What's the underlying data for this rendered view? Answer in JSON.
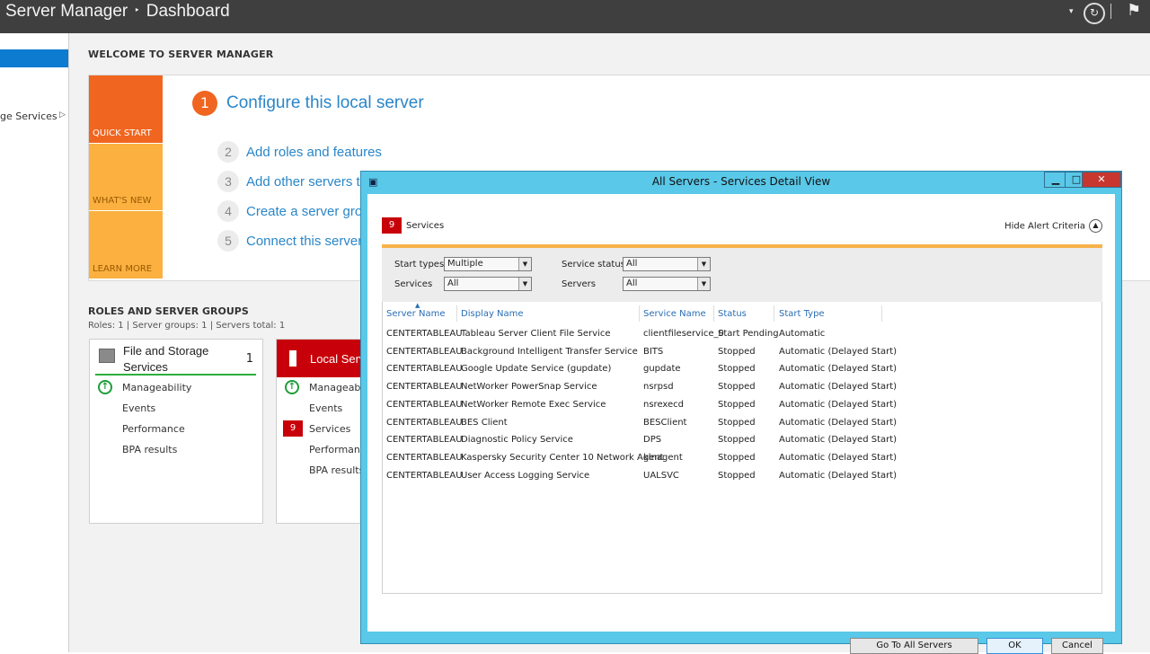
{
  "titlebar": {
    "app": "Server Manager",
    "separator": "‣",
    "page": "Dashboard"
  },
  "sidebar": {
    "selected_label": "",
    "item_label": "ge Services"
  },
  "welcome": {
    "heading": "WELCOME TO SERVER MANAGER",
    "tiles": [
      "QUICK START",
      "WHAT'S NEW",
      "LEARN MORE"
    ],
    "configure": {
      "num": "1",
      "label": "Configure this local server"
    },
    "steps": [
      {
        "num": "2",
        "label": "Add roles and features"
      },
      {
        "num": "3",
        "label": "Add other servers to manage"
      },
      {
        "num": "4",
        "label": "Create a server group"
      },
      {
        "num": "5",
        "label": "Connect this server to cloud services"
      }
    ]
  },
  "roles": {
    "heading": "ROLES AND SERVER GROUPS",
    "summary": "Roles: 1   |   Server groups: 1   |   Servers total: 1",
    "cards": [
      {
        "title_line1": "File and Storage",
        "title_line2": "Services",
        "count": "1",
        "items": [
          "Manageability",
          "Events",
          "Performance",
          "BPA results"
        ]
      },
      {
        "title": "Local Server",
        "badge": "9",
        "items": [
          "Manageability",
          "Events",
          "Services",
          "Performance",
          "BPA results"
        ]
      }
    ]
  },
  "dialog": {
    "title": "All Servers - Services Detail View",
    "services_count": "9",
    "services_label": "Services",
    "hide_alert": "Hide Alert Criteria",
    "filters": {
      "start_types_label": "Start types",
      "start_types_value": "Multiple",
      "services_label": "Services",
      "services_value": "All",
      "service_status_label": "Service status",
      "service_status_value": "All",
      "servers_label": "Servers",
      "servers_value": "All"
    },
    "columns": [
      "Server Name",
      "Display Name",
      "Service Name",
      "Status",
      "Start Type"
    ],
    "rows": [
      [
        "CENTERTABLEAU",
        "Tableau Server Client File Service",
        "clientfileservice_0",
        "Start Pending",
        "Automatic"
      ],
      [
        "CENTERTABLEAU",
        "Background Intelligent Transfer Service",
        "BITS",
        "Stopped",
        "Automatic (Delayed Start)"
      ],
      [
        "CENTERTABLEAU",
        "Google Update Service (gupdate)",
        "gupdate",
        "Stopped",
        "Automatic (Delayed Start)"
      ],
      [
        "CENTERTABLEAU",
        "NetWorker PowerSnap Service",
        "nsrpsd",
        "Stopped",
        "Automatic (Delayed Start)"
      ],
      [
        "CENTERTABLEAU",
        "NetWorker Remote Exec Service",
        "nsrexecd",
        "Stopped",
        "Automatic (Delayed Start)"
      ],
      [
        "CENTERTABLEAU",
        "BES Client",
        "BESClient",
        "Stopped",
        "Automatic (Delayed Start)"
      ],
      [
        "CENTERTABLEAU",
        "Diagnostic Policy Service",
        "DPS",
        "Stopped",
        "Automatic (Delayed Start)"
      ],
      [
        "CENTERTABLEAU",
        "Kaspersky Security Center 10 Network Agent",
        "klnagent",
        "Stopped",
        "Automatic (Delayed Start)"
      ],
      [
        "CENTERTABLEAU",
        "User Access Logging Service",
        "UALSVC",
        "Stopped",
        "Automatic (Delayed Start)"
      ]
    ],
    "buttons": {
      "goto": "Go To All Servers",
      "ok": "OK",
      "cancel": "Cancel"
    }
  },
  "colors": {
    "accent_orange": "#f0651f",
    "tile_yellow": "#fbb040",
    "alert_red": "#c8000a",
    "dialog_frame": "#5ac8e8",
    "link_blue": "#2a86c8"
  }
}
